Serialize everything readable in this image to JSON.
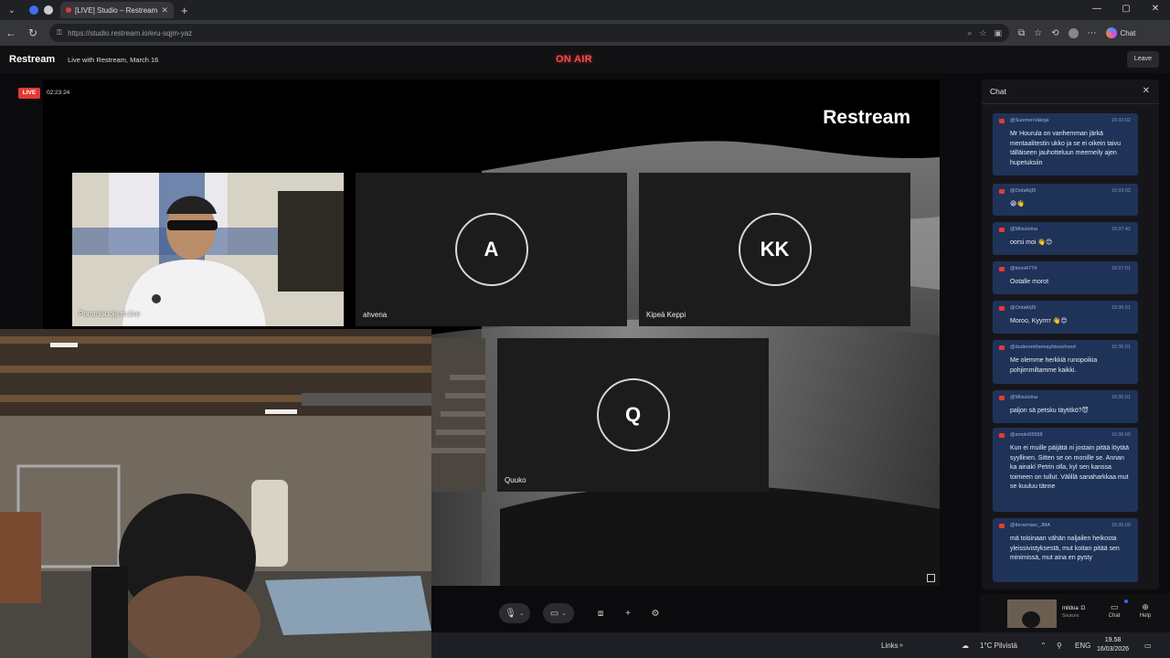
{
  "browser": {
    "tab_title": "[LIVE] Studio – Restream",
    "tab_close": "✕",
    "new_tab": "+",
    "window_controls": [
      "—",
      "▢",
      "✕"
    ],
    "url": "https://studio.restream.io/eru-sqjm-yaz",
    "chat_button": "Chat"
  },
  "studio": {
    "brand": "Restream",
    "stream_title": "Live with Restream, March 16",
    "on_air": "ON AIR",
    "leave": "Leave",
    "live_badge": "LIVE",
    "timer": "02:23:24",
    "canvas_logo": "Restream"
  },
  "participants": {
    "camera": {
      "name": "Pommisuoja.m.live"
    },
    "tiles": [
      {
        "initials": "A",
        "name": "ahvena"
      },
      {
        "initials": "KK",
        "name": "Kipeä Keppi"
      },
      {
        "initials": "Q",
        "name": "Quuko"
      }
    ]
  },
  "controls": {
    "mic_icon": "microphone-icon",
    "camera_icon": "camera-icon",
    "share_icon": "screen-share-icon",
    "add_icon": "plus-icon",
    "settings_icon": "gear-icon"
  },
  "sidebar_bottom": {
    "source_name": "mildoa :D",
    "source_sub": "Sources",
    "chat_label": "Chat",
    "help_label": "Help"
  },
  "chat": {
    "title": "Chat",
    "close": "✕",
    "messages": [
      {
        "user": "@SuomenVakoja",
        "time": "19:33:02",
        "text": "Mr Hourula on vanhemman järkä mentaalitestin ukko ja se ei oikein taivu tälläiseen jauhotteluun meemeily ajen hupetuksiin"
      },
      {
        "user": "@OotaKijf3",
        "time": "19:33:02",
        "text": "😁👋"
      },
      {
        "user": "@Miisuloina",
        "time": "19:37:42",
        "text": "oorsi moi 👋😊"
      },
      {
        "user": "@kioni4774",
        "time": "19:37:01",
        "text": "Ootalle morot"
      },
      {
        "user": "@OotaKijf3",
        "time": "19:36:51",
        "text": "Moroo, Kyyrrrr 👋😊"
      },
      {
        "user": "@duderomthemayhbourhood",
        "time": "19:36:01",
        "text": "Me olemme herkkiä runopoikia pohjimmiltamme kaikki."
      },
      {
        "user": "@Miisuloina",
        "time": "19:36:01",
        "text": "paljon sä petsku täytitkö?😈"
      },
      {
        "user": "@smolo55558",
        "time": "19:36:00",
        "text": "Kun ei muille päijätä ni jostain pitää löytää syyllinen. Sitten se on monille se. Annan ka ainakí Petrin olla, kyl sen kanssa toimeen on tullut. Välillä sanaharkkaa mut se kuuluu tänne"
      },
      {
        "user": "@throemian_JMA",
        "time": "19:35:00",
        "text": "mä toisinaan vähän naljailen heikosta yleissivistyksestä, mut koitan pitää sen minimissä, mut aina en pysty"
      }
    ]
  },
  "taskbar": {
    "links": "Links",
    "weather": "1°C  Pilvistä",
    "language": "ENG",
    "time": "19.58",
    "date": "16/03/2026"
  },
  "colors": {
    "on_air": "#ff4d4d",
    "live": "#e53935",
    "chat_bubble": "#1f3358"
  }
}
